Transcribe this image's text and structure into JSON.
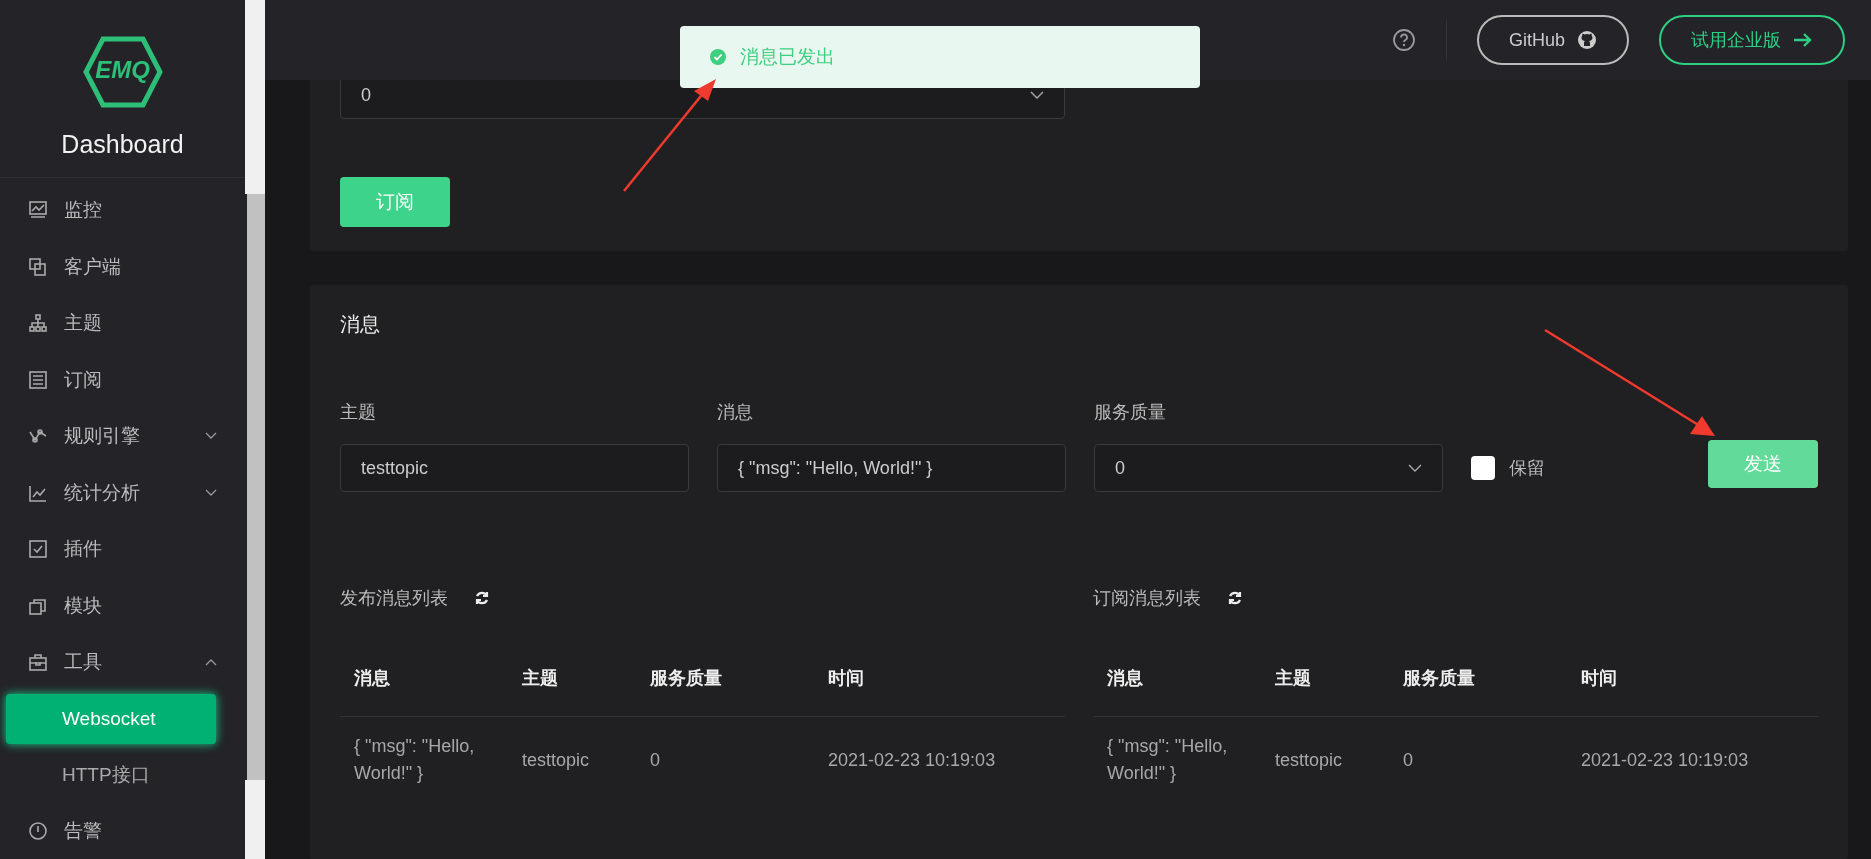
{
  "sidebar": {
    "logo_text": "EMQ",
    "title": "Dashboard",
    "items": [
      {
        "label": "监控"
      },
      {
        "label": "客户端"
      },
      {
        "label": "主题"
      },
      {
        "label": "订阅"
      },
      {
        "label": "规则引擎",
        "expanded": false
      },
      {
        "label": "统计分析",
        "expanded": false
      },
      {
        "label": "插件"
      },
      {
        "label": "模块"
      },
      {
        "label": "工具",
        "expanded": true,
        "children": [
          {
            "label": "Websocket",
            "selected": true
          },
          {
            "label": "HTTP接口",
            "selected": false
          }
        ]
      },
      {
        "label": "告警"
      }
    ]
  },
  "header": {
    "github_button": "GitHub",
    "trial_button": "试用企业版"
  },
  "toast": {
    "text": "消息已发出"
  },
  "subscribe_card": {
    "qos_value": "0",
    "subscribe_button": "订阅"
  },
  "message_card": {
    "title": "消息",
    "topic_label": "主题",
    "topic_value": "testtopic",
    "message_label": "消息",
    "message_value": "{ \"msg\": \"Hello, World!\" }",
    "qos_label": "服务质量",
    "qos_value": "0",
    "retain": {
      "label": "保留",
      "checked": false
    },
    "send_button": "发送"
  },
  "lists": [
    {
      "title": "发布消息列表",
      "columns": [
        "消息",
        "主题",
        "服务质量",
        "时间"
      ],
      "rows": [
        [
          "{ \"msg\": \"Hello, World!\" }",
          "testtopic",
          "0",
          "2021-02-23 10:19:03"
        ]
      ]
    },
    {
      "title": "订阅消息列表",
      "columns": [
        "消息",
        "主题",
        "服务质量",
        "时间"
      ],
      "rows": [
        [
          "{ \"msg\": \"Hello, World!\" }",
          "testtopic",
          "0",
          "2021-02-23 10:19:03"
        ]
      ]
    }
  ]
}
